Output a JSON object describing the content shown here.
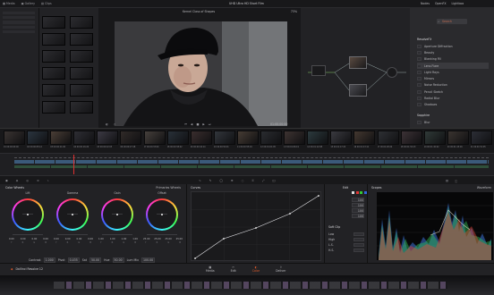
{
  "app": {
    "title": "UHD Ultra HD Short Film",
    "logo_name": "DaVinci Resolve 12"
  },
  "topbar": {
    "left_buttons": [
      "Media",
      "Gallery",
      "Clips"
    ],
    "center_label": "Kernel Class of Shapes",
    "zoom": "73%",
    "right_buttons": [
      "Nodes",
      "OpenFX",
      "Lightbox"
    ]
  },
  "viewer": {
    "timecode": "01:00:00:00"
  },
  "openfx": {
    "search_placeholder": "Search",
    "section1": "ResolveFX",
    "items1": [
      "Aperture Diffraction",
      "Beauty",
      "Blanking Fill",
      "Lens Flare",
      "Light Rays",
      "Mirrors",
      "Noise Reduction",
      "Pencil Sketch",
      "Radial Blur",
      "Shadows"
    ],
    "section2": "Sapphire",
    "items2": [
      "Blur",
      "Blur Chroma",
      "Glow",
      "Sharpen"
    ]
  },
  "timeline": {
    "clip_labels": [
      "01 00:00:00:00",
      "02 00:00:05:12",
      "03 00:00:11:06",
      "04 00:00:16:20",
      "05 00:00:22:03",
      "06 00:00:27:18",
      "07 00:00:33:09",
      "08 00:00:38:22",
      "09 00:00:44:14",
      "10 00:00:50:01",
      "11 00:00:55:16",
      "12 00:01:01:05",
      "13 00:01:06:19",
      "14 00:01:12:08",
      "15 00:01:17:22",
      "16 00:01:23:11",
      "17 00:01:28:24",
      "18 00:01:34:13",
      "19 00:01:40:02",
      "20 00:01:45:16",
      "21 00:01:51:05"
    ]
  },
  "color_wheels": {
    "panel_title": "Color Wheels",
    "mode": "Primaries Wheels",
    "wheels": [
      {
        "name": "Lift",
        "values": [
          "0.00",
          "0.00",
          "0.00",
          "0.00"
        ]
      },
      {
        "name": "Gamma",
        "values": [
          "0.00",
          "0.00",
          "0.00",
          "0.00"
        ]
      },
      {
        "name": "Gain",
        "values": [
          "1.00",
          "1.00",
          "1.00",
          "1.00"
        ]
      },
      {
        "name": "Offset",
        "values": [
          "25.00",
          "25.00",
          "25.00",
          "25.00"
        ]
      }
    ],
    "bottom_params": [
      "Contrast",
      "1.000",
      "Pivot",
      "0.435",
      "Sat",
      "50.00",
      "Hue",
      "50.00",
      "Lum Mix",
      "100.00"
    ]
  },
  "curves": {
    "title": "Curves",
    "edit_label": "Edit",
    "soft_clip": "Soft Clip",
    "values": [
      "100",
      "100",
      "100",
      "100"
    ],
    "row_labels": [
      "Low",
      "High",
      "L.S.",
      "H.S."
    ]
  },
  "scopes": {
    "title": "Scopes",
    "mode": "Waveform"
  },
  "bottom_tabs": [
    "Media",
    "Edit",
    "Color",
    "Deliver"
  ],
  "colors": {
    "accent": "#e05a2a",
    "playhead": "#e03030",
    "bg": "#1b1b1d"
  }
}
